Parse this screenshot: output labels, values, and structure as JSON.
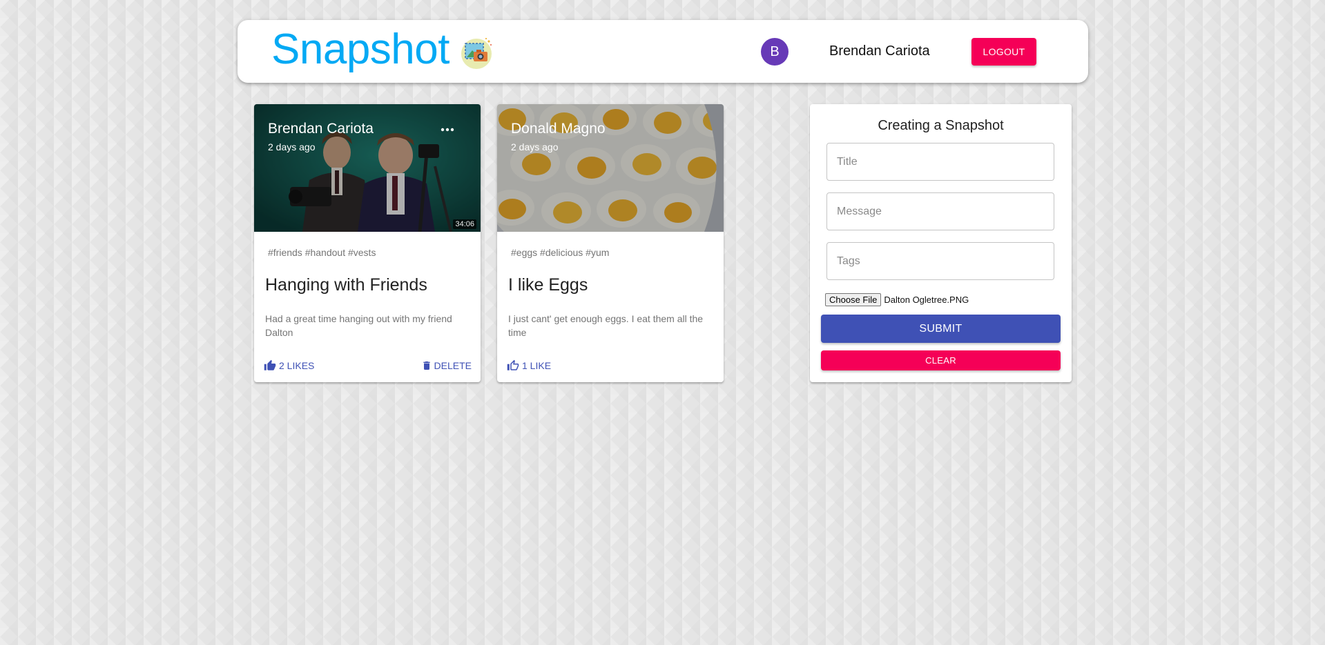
{
  "app": {
    "brand": "Snapshot",
    "user_initial": "B",
    "user_name": "Brendan Cariota",
    "logout_label": "LOGOUT",
    "brand_color": "#03a9f4",
    "accent_primary": "#3f51b5",
    "accent_secondary": "#f50057",
    "avatar_color": "#673ab7"
  },
  "posts": [
    {
      "creator": "Brendan Cariota",
      "created": "2 days ago",
      "media_badge": "34:06",
      "tags": "#friends #handout #vests",
      "title": "Hanging with Friends",
      "message": "Had a great time hanging out with my friend Dalton",
      "likes_label": "2 LIKES",
      "delete_label": "DELETE",
      "like_icon": "thumb-up-filled-icon",
      "delete_icon": "trash-icon",
      "more_icon": "more-horizontal-icon"
    },
    {
      "creator": "Donald Magno",
      "created": "2 days ago",
      "tags": "#eggs #delicious #yum",
      "title": "I like Eggs",
      "message": "I just cant' get enough eggs. I eat them all the time",
      "likes_label": "1 LIKE",
      "like_icon": "thumb-up-outline-icon"
    }
  ],
  "form": {
    "title": "Creating a Snapshot",
    "title_placeholder": "Title",
    "message_placeholder": "Message",
    "tags_placeholder": "Tags",
    "choose_file_label": "Choose File",
    "file_name": "Dalton Ogletree.PNG",
    "submit_label": "SUBMIT",
    "clear_label": "CLEAR"
  }
}
